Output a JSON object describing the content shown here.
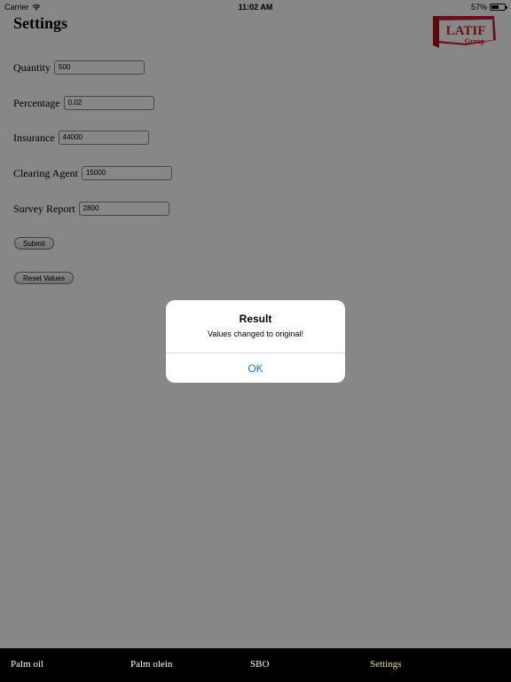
{
  "status_bar": {
    "carrier": "Carrier",
    "time": "11:02 AM",
    "battery": "57%",
    "battery_level": 0.57
  },
  "page": {
    "title": "Settings",
    "logo_text": "LATIF",
    "logo_subtext": "Group",
    "logo_color": "#c8202c"
  },
  "form": {
    "fields": [
      {
        "label": "Quantity",
        "value": "500"
      },
      {
        "label": "Percentage",
        "value": "0.02"
      },
      {
        "label": "Insurance",
        "value": "44000"
      },
      {
        "label": "Clearing Agent",
        "value": "15000"
      },
      {
        "label": "Survey Report",
        "value": "2800"
      }
    ],
    "submit_label": "Submit",
    "reset_label": "Reset Values"
  },
  "tabs": [
    {
      "label": "Palm oil"
    },
    {
      "label": "Palm olein"
    },
    {
      "label": "SBO"
    },
    {
      "label": "Settings",
      "active": true
    }
  ],
  "tab_active_color": "#e3e34a",
  "alert": {
    "title": "Result",
    "message": "Values changed to original!",
    "ok_label": "OK",
    "ok_color": "#1a73d6"
  }
}
